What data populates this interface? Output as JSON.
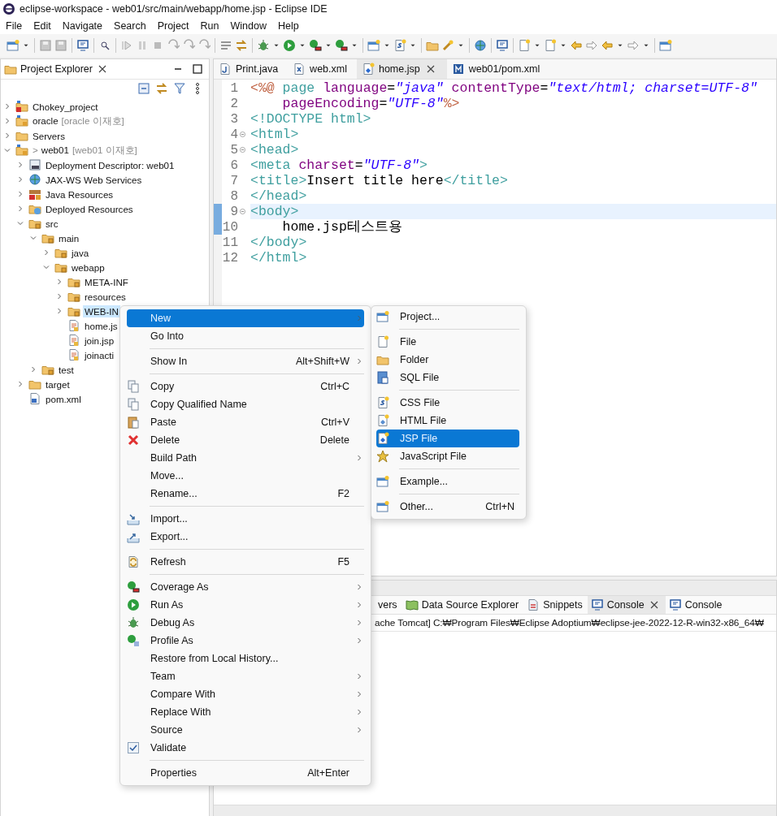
{
  "window": {
    "title": "eclipse-workspace - web01/src/main/webapp/home.jsp - Eclipse IDE"
  },
  "menu_bar": [
    "File",
    "Edit",
    "Navigate",
    "Search",
    "Project",
    "Run",
    "Window",
    "Help"
  ],
  "project_explorer": {
    "title": "Project Explorer",
    "tree": [
      {
        "label": "Chokey_project",
        "kind": "project-error",
        "expanded": false,
        "selected": false
      },
      {
        "label": "oracle",
        "decoration": "[oracle 이재호]",
        "kind": "project",
        "expanded": false,
        "selected": false
      },
      {
        "label": "Servers",
        "kind": "folder",
        "expanded": false,
        "selected": false
      },
      {
        "label": "web01",
        "prefix": ">",
        "decoration": "[web01 이재호]",
        "kind": "project",
        "expanded": true,
        "selected": false,
        "children": [
          {
            "label": "Deployment Descriptor: web01",
            "kind": "descriptor",
            "expanded": false,
            "selected": false
          },
          {
            "label": "JAX-WS Web Services",
            "kind": "services",
            "expanded": false,
            "selected": false
          },
          {
            "label": "Java Resources",
            "kind": "library",
            "expanded": false,
            "selected": false
          },
          {
            "label": "Deployed Resources",
            "kind": "deployed",
            "expanded": false,
            "selected": false
          },
          {
            "label": "src",
            "kind": "package-folder",
            "expanded": true,
            "selected": false,
            "children": [
              {
                "label": "main",
                "kind": "package-folder",
                "expanded": true,
                "selected": false,
                "children": [
                  {
                    "label": "java",
                    "kind": "package-folder",
                    "expanded": false,
                    "selected": false
                  },
                  {
                    "label": "webapp",
                    "kind": "package-folder",
                    "expanded": true,
                    "selected": false,
                    "children": [
                      {
                        "label": "META-INF",
                        "kind": "package-folder",
                        "expanded": false,
                        "selected": false
                      },
                      {
                        "label": "resources",
                        "kind": "package-folder",
                        "expanded": false,
                        "selected": false
                      },
                      {
                        "label": "WEB-IN",
                        "kind": "package-folder",
                        "expanded": false,
                        "selected": true
                      },
                      {
                        "label": "home.js",
                        "kind": "file",
                        "selected": false
                      },
                      {
                        "label": "join.jsp",
                        "kind": "file",
                        "selected": false
                      },
                      {
                        "label": "joinacti",
                        "kind": "file",
                        "selected": false
                      }
                    ]
                  }
                ]
              },
              {
                "label": "test",
                "kind": "package-folder",
                "expanded": false,
                "selected": false
              }
            ]
          },
          {
            "label": "target",
            "kind": "folder",
            "expanded": false,
            "selected": false
          },
          {
            "label": "pom.xml",
            "kind": "xml-file",
            "selected": false
          }
        ]
      }
    ]
  },
  "editor": {
    "tabs": [
      {
        "label": "Print.java",
        "kind": "java",
        "selected": false
      },
      {
        "label": "web.xml",
        "kind": "xml",
        "selected": false
      },
      {
        "label": "home.jsp",
        "kind": "jsp",
        "selected": true
      },
      {
        "label": "web01/pom.xml",
        "kind": "pom",
        "selected": false
      }
    ],
    "lines": [
      {
        "number": "1",
        "foldable": false,
        "current": false,
        "changed": false,
        "tokens": [
          {
            "kind": "directive",
            "text": "<%@"
          },
          {
            "kind": "tag",
            "text": " page"
          },
          {
            "kind": "attr",
            "text": " language"
          },
          {
            "kind": "plain",
            "text": "="
          },
          {
            "kind": "string",
            "text": "\"java\""
          },
          {
            "kind": "attr",
            "text": " contentType"
          },
          {
            "kind": "plain",
            "text": "="
          },
          {
            "kind": "string",
            "text": "\"text/html; charset=UTF-8\""
          }
        ]
      },
      {
        "number": "2",
        "foldable": false,
        "current": false,
        "changed": false,
        "tokens": [
          {
            "kind": "attr",
            "text": "    pageEncoding"
          },
          {
            "kind": "plain",
            "text": "="
          },
          {
            "kind": "string",
            "text": "\"UTF-8\""
          },
          {
            "kind": "directive",
            "text": "%>"
          }
        ]
      },
      {
        "number": "3",
        "foldable": false,
        "current": false,
        "changed": false,
        "tokens": [
          {
            "kind": "tag",
            "text": "<!DOCTYPE html>"
          }
        ]
      },
      {
        "number": "4",
        "foldable": true,
        "current": false,
        "changed": false,
        "tokens": [
          {
            "kind": "tag",
            "text": "<html>"
          }
        ]
      },
      {
        "number": "5",
        "foldable": true,
        "current": false,
        "changed": false,
        "tokens": [
          {
            "kind": "tag",
            "text": "<head>"
          }
        ]
      },
      {
        "number": "6",
        "foldable": false,
        "current": false,
        "changed": false,
        "tokens": [
          {
            "kind": "tag",
            "text": "<meta"
          },
          {
            "kind": "attr",
            "text": " charset"
          },
          {
            "kind": "plain",
            "text": "="
          },
          {
            "kind": "string",
            "text": "\"UTF-8\""
          },
          {
            "kind": "tag",
            "text": ">"
          }
        ]
      },
      {
        "number": "7",
        "foldable": false,
        "current": false,
        "changed": false,
        "tokens": [
          {
            "kind": "tag",
            "text": "<title>"
          },
          {
            "kind": "plain",
            "text": "Insert title here"
          },
          {
            "kind": "tag",
            "text": "</title>"
          }
        ]
      },
      {
        "number": "8",
        "foldable": false,
        "current": false,
        "changed": false,
        "tokens": [
          {
            "kind": "tag",
            "text": "</head>"
          }
        ]
      },
      {
        "number": "9",
        "foldable": true,
        "current": true,
        "changed": true,
        "tokens": [
          {
            "kind": "tag",
            "text": "<body>"
          }
        ]
      },
      {
        "number": "10",
        "foldable": false,
        "current": false,
        "changed": true,
        "tokens": [
          {
            "kind": "plain",
            "text": "    home.jsp테스트용"
          }
        ]
      },
      {
        "number": "11",
        "foldable": false,
        "current": false,
        "changed": false,
        "tokens": [
          {
            "kind": "tag",
            "text": "</body>"
          }
        ]
      },
      {
        "number": "12",
        "foldable": false,
        "current": false,
        "changed": false,
        "tokens": [
          {
            "kind": "tag",
            "text": "</html>"
          }
        ]
      }
    ]
  },
  "bottom_panel": {
    "tabs": [
      {
        "label": "vers",
        "kind": "none",
        "selected": false
      },
      {
        "label": "Data Source Explorer",
        "kind": "datasource",
        "selected": false
      },
      {
        "label": "Snippets",
        "kind": "snippets",
        "selected": false
      },
      {
        "label": "Console",
        "kind": "console",
        "selected": true
      },
      {
        "label": "Console",
        "kind": "console",
        "selected": false
      }
    ],
    "console_line": "ache Tomcat] C:₩Program Files₩Eclipse Adoptium₩eclipse-jee-2022-12-R-win32-x86_64₩"
  },
  "context_menu": {
    "items": [
      {
        "kind": "item",
        "label": "New",
        "submenu": true,
        "selected": true
      },
      {
        "kind": "item",
        "label": "Go Into",
        "submenu": false,
        "selected": false
      },
      {
        "kind": "separator"
      },
      {
        "kind": "item",
        "label": "Show In",
        "shortcut": "Alt+Shift+W",
        "submenu": true,
        "selected": false
      },
      {
        "kind": "separator"
      },
      {
        "kind": "item",
        "label": "Copy",
        "shortcut": "Ctrl+C",
        "submenu": false,
        "selected": false
      },
      {
        "kind": "item",
        "label": "Copy Qualified Name",
        "submenu": false,
        "selected": false
      },
      {
        "kind": "item",
        "label": "Paste",
        "shortcut": "Ctrl+V",
        "submenu": false,
        "selected": false
      },
      {
        "kind": "item",
        "label": "Delete",
        "shortcut": "Delete",
        "submenu": false,
        "selected": false
      },
      {
        "kind": "item",
        "label": "Build Path",
        "submenu": true,
        "selected": false
      },
      {
        "kind": "item",
        "label": "Move...",
        "submenu": false,
        "selected": false
      },
      {
        "kind": "item",
        "label": "Rename...",
        "shortcut": "F2",
        "submenu": false,
        "selected": false
      },
      {
        "kind": "separator"
      },
      {
        "kind": "item",
        "label": "Import...",
        "submenu": false,
        "selected": false
      },
      {
        "kind": "item",
        "label": "Export...",
        "submenu": false,
        "selected": false
      },
      {
        "kind": "separator"
      },
      {
        "kind": "item",
        "label": "Refresh",
        "shortcut": "F5",
        "submenu": false,
        "selected": false
      },
      {
        "kind": "separator"
      },
      {
        "kind": "item",
        "label": "Coverage As",
        "submenu": true,
        "selected": false
      },
      {
        "kind": "item",
        "label": "Run As",
        "submenu": true,
        "selected": false
      },
      {
        "kind": "item",
        "label": "Debug As",
        "submenu": true,
        "selected": false
      },
      {
        "kind": "item",
        "label": "Profile As",
        "submenu": true,
        "selected": false
      },
      {
        "kind": "item",
        "label": "Restore from Local History...",
        "submenu": false,
        "selected": false
      },
      {
        "kind": "item",
        "label": "Team",
        "submenu": true,
        "selected": false
      },
      {
        "kind": "item",
        "label": "Compare With",
        "submenu": true,
        "selected": false
      },
      {
        "kind": "item",
        "label": "Replace With",
        "submenu": true,
        "selected": false
      },
      {
        "kind": "item",
        "label": "Source",
        "submenu": true,
        "selected": false
      },
      {
        "kind": "item",
        "label": "Validate",
        "submenu": false,
        "selected": false
      },
      {
        "kind": "separator"
      },
      {
        "kind": "item",
        "label": "Properties",
        "shortcut": "Alt+Enter",
        "submenu": false,
        "selected": false
      }
    ]
  },
  "submenu": {
    "items": [
      {
        "kind": "item",
        "label": "Project...",
        "selected": false
      },
      {
        "kind": "separator"
      },
      {
        "kind": "item",
        "label": "File",
        "selected": false
      },
      {
        "kind": "item",
        "label": "Folder",
        "selected": false
      },
      {
        "kind": "item",
        "label": "SQL File",
        "selected": false
      },
      {
        "kind": "separator"
      },
      {
        "kind": "item",
        "label": "CSS File",
        "selected": false
      },
      {
        "kind": "item",
        "label": "HTML File",
        "selected": false
      },
      {
        "kind": "item",
        "label": "JSP File",
        "selected": true
      },
      {
        "kind": "item",
        "label": "JavaScript File",
        "selected": false
      },
      {
        "kind": "separator"
      },
      {
        "kind": "item",
        "label": "Example...",
        "selected": false
      },
      {
        "kind": "separator"
      },
      {
        "kind": "item",
        "label": "Other...",
        "shortcut": "Ctrl+N",
        "selected": false
      }
    ]
  }
}
